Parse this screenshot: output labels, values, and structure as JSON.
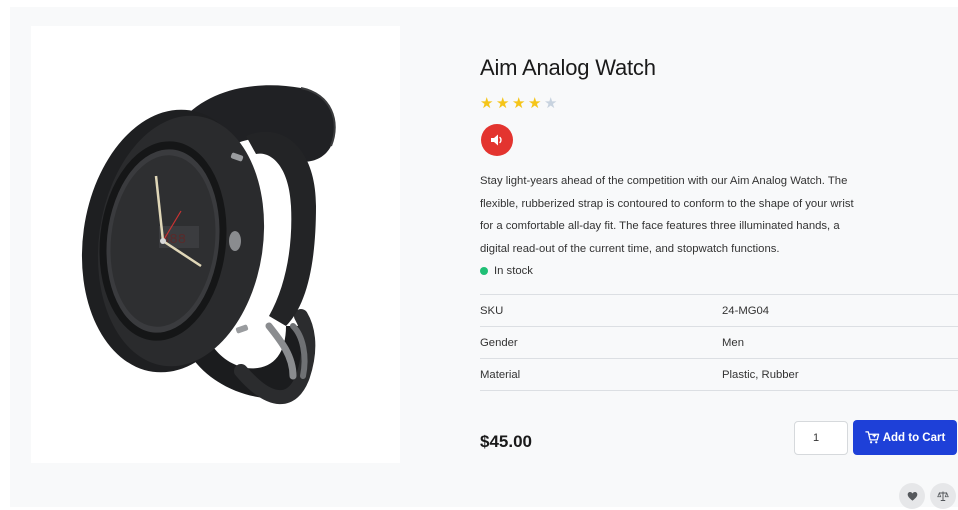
{
  "product": {
    "title": "Aim Analog Watch",
    "rating": 4,
    "rating_max": 5,
    "description": "Stay light-years ahead of the competition with our Aim Analog Watch. The flexible, rubberized strap is contoured to conform to the shape of your wrist for a comfortable all-day fit. The face features three illuminated hands, a digital read-out of the current time, and stopwatch functions.",
    "stock_status": "In stock",
    "price": "$45.00",
    "quantity": "1"
  },
  "specs": [
    {
      "label": "SKU",
      "value": "24-MG04"
    },
    {
      "label": "Gender",
      "value": "Men"
    },
    {
      "label": "Material",
      "value": "Plastic, Rubber"
    }
  ],
  "actions": {
    "add_to_cart_label": "Add to Cart",
    "audio_icon": "speaker-icon",
    "wishlist_icon": "heart-icon",
    "compare_icon": "scale-icon"
  },
  "colors": {
    "accent": "#1e40d8",
    "audio": "#e3342f",
    "star_filled": "#f5c518",
    "star_empty": "#c8d3df",
    "in_stock": "#1fbf75"
  }
}
